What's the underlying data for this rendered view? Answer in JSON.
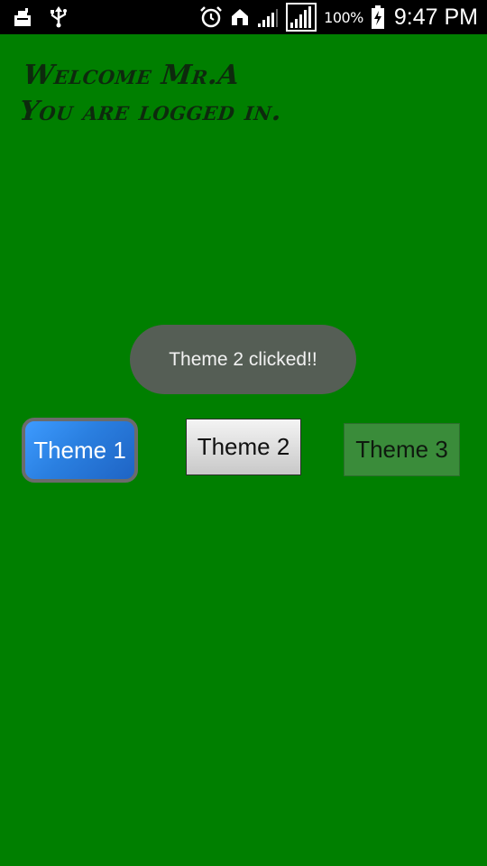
{
  "status_bar": {
    "left_icons": [
      "cleaner-icon",
      "usb-icon"
    ],
    "right_icons": [
      "alarm-icon",
      "home-icon",
      "signal-weak-icon",
      "signal-strong-icon",
      "charging-icon"
    ],
    "battery": "100%",
    "time": "9:47 PM"
  },
  "welcome": {
    "line1": "Welcome Mr.A",
    "line2": "You are logged in."
  },
  "toast": {
    "message": "Theme 2 clicked!!"
  },
  "buttons": [
    {
      "label": "Theme 1"
    },
    {
      "label": "Theme 2"
    },
    {
      "label": "Theme 3"
    }
  ],
  "colors": {
    "background": "#007f00",
    "status_bar": "#000000",
    "toast": "#555e55",
    "theme1_button": "#2a7fe0",
    "theme2_button": "#dcdcdc",
    "theme3_button": "#3a8c3a"
  }
}
